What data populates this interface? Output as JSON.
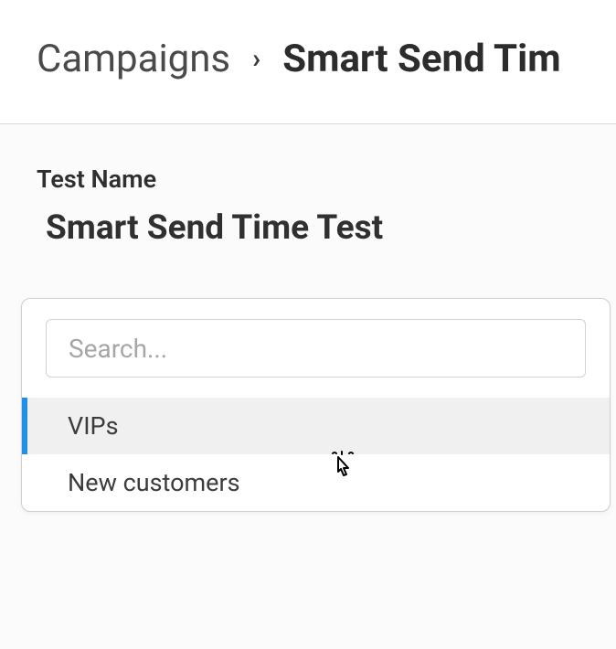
{
  "breadcrumb": {
    "parent": "Campaigns",
    "current": "Smart Send Tim"
  },
  "form": {
    "test_name_label": "Test Name",
    "test_name_value": "Smart Send Time Test"
  },
  "dropdown": {
    "search_placeholder": "Search...",
    "items": [
      {
        "label": "VIPs"
      },
      {
        "label": "New customers"
      }
    ]
  }
}
